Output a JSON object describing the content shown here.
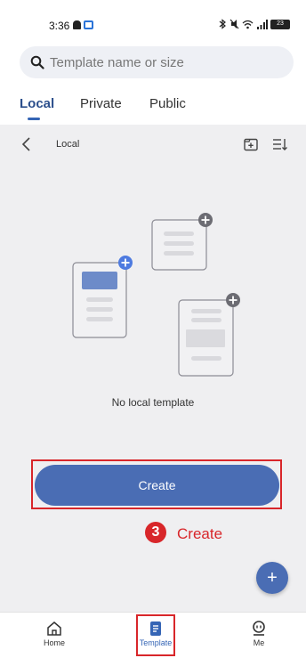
{
  "status_bar": {
    "time": "3:36",
    "battery": "23"
  },
  "search": {
    "placeholder": "Template name or size"
  },
  "tabs": [
    {
      "label": "Local",
      "active": true
    },
    {
      "label": "Private",
      "active": false
    },
    {
      "label": "Public",
      "active": false
    }
  ],
  "breadcrumb": {
    "title": "Local"
  },
  "empty_state": {
    "message": "No local template"
  },
  "create_button": {
    "label": "Create"
  },
  "annotation": {
    "step_number": "3",
    "step_label": "Create"
  },
  "fab": {
    "label": "+"
  },
  "bottom_nav": [
    {
      "label": "Home",
      "icon": "home-icon",
      "active": false
    },
    {
      "label": "Template",
      "icon": "template-icon",
      "active": true
    },
    {
      "label": "Me",
      "icon": "me-icon",
      "active": false
    }
  ],
  "colors": {
    "accent": "#4a6db4",
    "tab_active": "#2c4f8c",
    "annotation": "#d8262a",
    "background": "#efeff1"
  }
}
